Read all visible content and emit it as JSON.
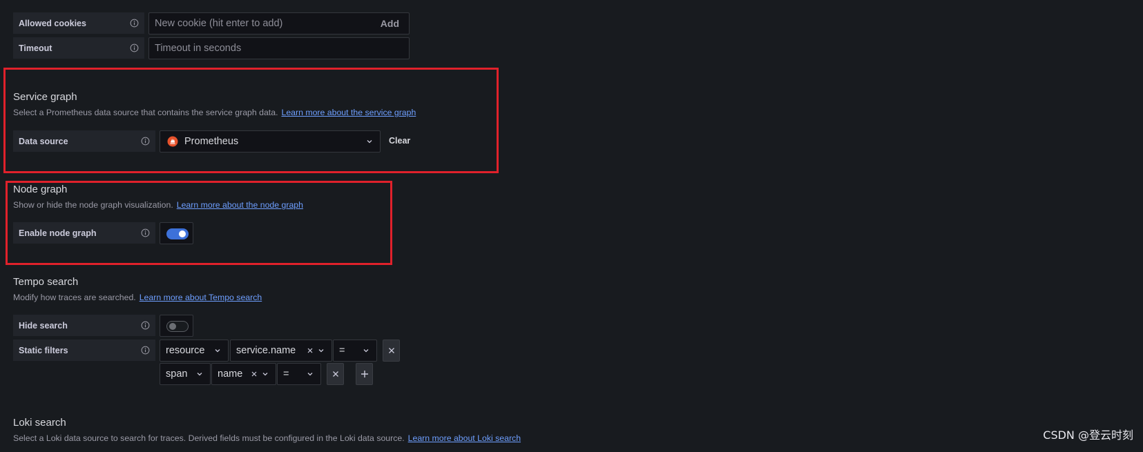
{
  "cookies": {
    "label": "Allowed cookies",
    "placeholder": "New cookie (hit enter to add)",
    "add_label": "Add"
  },
  "timeout": {
    "label": "Timeout",
    "placeholder": "Timeout in seconds"
  },
  "service_graph": {
    "title": "Service graph",
    "description": "Select a Prometheus data source that contains the service graph data.",
    "link": "Learn more about the service graph",
    "datasource_label": "Data source",
    "datasource_value": "Prometheus",
    "clear_label": "Clear"
  },
  "node_graph": {
    "title": "Node graph",
    "description": "Show or hide the node graph visualization.",
    "link": "Learn more about the node graph",
    "toggle_label": "Enable node graph",
    "enabled": true
  },
  "tempo_search": {
    "title": "Tempo search",
    "description": "Modify how traces are searched.",
    "link": "Learn more about Tempo search",
    "hide_search_label": "Hide search",
    "hide_search_enabled": false,
    "static_filters_label": "Static filters",
    "filters": [
      {
        "scope": "resource",
        "tag": "service.name",
        "operator": "="
      },
      {
        "scope": "span",
        "tag": "name",
        "operator": "="
      }
    ]
  },
  "loki_search": {
    "title": "Loki search",
    "description": "Select a Loki data source to search for traces. Derived fields must be configured in the Loki data source.",
    "link": "Learn more about Loki search"
  },
  "watermark": "CSDN @登云时刻",
  "colors": {
    "background": "#181b1f",
    "highlight_border": "#e0212b",
    "link": "#6e9fff",
    "toggle_on": "#3d71d9"
  }
}
